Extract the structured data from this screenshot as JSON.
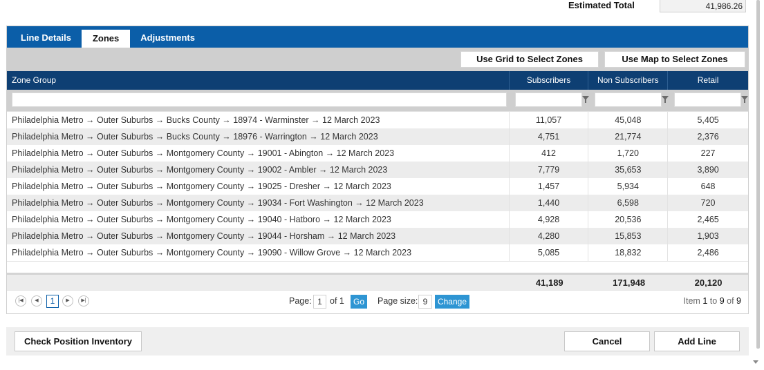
{
  "estimated_total": {
    "label": "Estimated Total",
    "value": "41,986.26"
  },
  "tabs": [
    {
      "label": "Line Details",
      "active": false
    },
    {
      "label": "Zones",
      "active": true
    },
    {
      "label": "Adjustments",
      "active": false
    }
  ],
  "toolbar": {
    "grid_button": "Use Grid to Select Zones",
    "map_button": "Use Map to Select Zones"
  },
  "grid": {
    "columns": {
      "zone": "Zone Group",
      "subscribers": "Subscribers",
      "non_subscribers": "Non Subscribers",
      "retail": "Retail"
    },
    "rows": [
      {
        "zone": "Philadelphia Metro → Outer Suburbs → Bucks County → 18974 - Warminster → 12 March 2023",
        "subscribers": "11,057",
        "non_subscribers": "45,048",
        "retail": "5,405"
      },
      {
        "zone": "Philadelphia Metro → Outer Suburbs → Bucks County → 18976 - Warrington → 12 March 2023",
        "subscribers": "4,751",
        "non_subscribers": "21,774",
        "retail": "2,376"
      },
      {
        "zone": "Philadelphia Metro → Outer Suburbs → Montgomery County → 19001 - Abington → 12 March 2023",
        "subscribers": "412",
        "non_subscribers": "1,720",
        "retail": "227"
      },
      {
        "zone": "Philadelphia Metro → Outer Suburbs → Montgomery County → 19002 - Ambler → 12 March 2023",
        "subscribers": "7,779",
        "non_subscribers": "35,653",
        "retail": "3,890"
      },
      {
        "zone": "Philadelphia Metro → Outer Suburbs → Montgomery County → 19025 - Dresher → 12 March 2023",
        "subscribers": "1,457",
        "non_subscribers": "5,934",
        "retail": "648"
      },
      {
        "zone": "Philadelphia Metro → Outer Suburbs → Montgomery County → 19034 - Fort Washington → 12 March 2023",
        "subscribers": "1,440",
        "non_subscribers": "6,598",
        "retail": "720"
      },
      {
        "zone": "Philadelphia Metro → Outer Suburbs → Montgomery County → 19040 - Hatboro → 12 March 2023",
        "subscribers": "4,928",
        "non_subscribers": "20,536",
        "retail": "2,465"
      },
      {
        "zone": "Philadelphia Metro → Outer Suburbs → Montgomery County → 19044 - Horsham → 12 March 2023",
        "subscribers": "4,280",
        "non_subscribers": "15,853",
        "retail": "1,903"
      },
      {
        "zone": "Philadelphia Metro → Outer Suburbs → Montgomery County → 19090 - Willow Grove → 12 March 2023",
        "subscribers": "5,085",
        "non_subscribers": "18,832",
        "retail": "2,486"
      }
    ],
    "totals": {
      "subscribers": "41,189",
      "non_subscribers": "171,948",
      "retail": "20,120"
    }
  },
  "pager": {
    "current_page": "1",
    "page_label": "Page:",
    "page_value": "1",
    "of_label": "of 1",
    "go_label": "Go",
    "page_size_label": "Page size:",
    "page_size_value": "9",
    "change_label": "Change",
    "item_prefix": "Item",
    "item_from": "1",
    "item_to_label": "to",
    "item_to": "9",
    "item_of_label": "of",
    "item_total": "9",
    "icons": [
      "first-page-icon",
      "prev-page-icon",
      "next-page-icon",
      "last-page-icon"
    ]
  },
  "footer": {
    "check_label": "Check Position Inventory",
    "cancel_label": "Cancel",
    "add_label": "Add Line"
  },
  "colors": {
    "tab_bar": "#0b5ea8",
    "grid_header": "#0e3f73",
    "accent_button": "#2e95d3"
  }
}
